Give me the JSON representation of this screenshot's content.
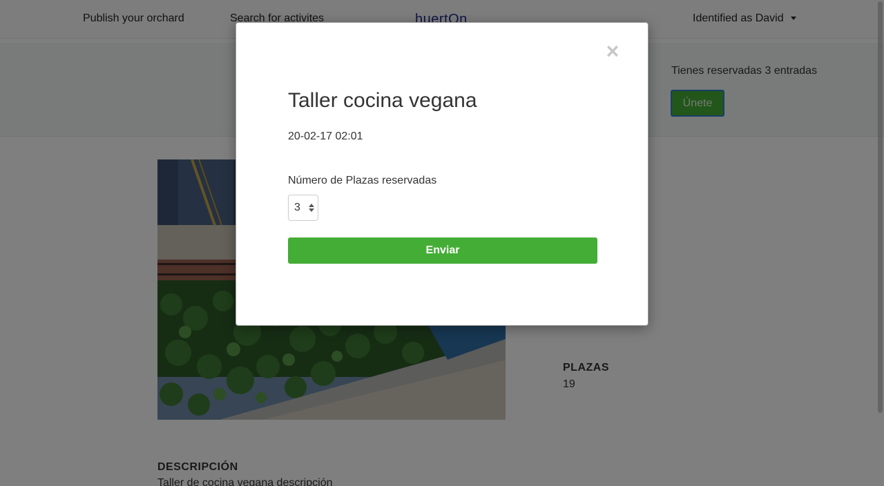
{
  "nav": {
    "publish": "Publish your orchard",
    "search": "Search for activites",
    "brand": "huertOn",
    "user": "Identified as David"
  },
  "banner": {
    "reserved_text": "Tienes reservadas 3 entradas",
    "join_label": "Únete"
  },
  "details": {
    "plazas_label": "PLAZAS",
    "plazas_value": "19",
    "description_label": "DESCRIPCIÓN",
    "description_value": "Taller de cocina vegana descripción"
  },
  "modal": {
    "close_glyph": "×",
    "title": "Taller cocina vegana",
    "date": "20-02-17 02:01",
    "seats_label": "Número de Plazas reservadas",
    "seats_value": "3",
    "submit_label": "Enviar"
  },
  "colors": {
    "accent_green": "#44ad35",
    "brand_blue": "#1f2a8a",
    "focus_blue": "#2e7fd6"
  }
}
